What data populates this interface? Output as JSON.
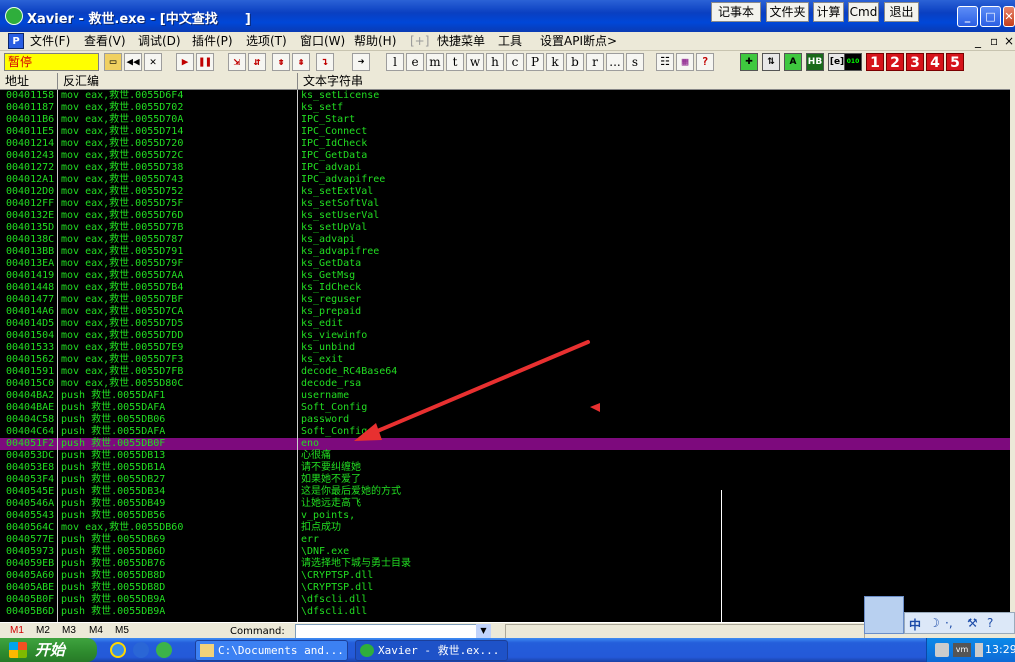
{
  "window": {
    "title": "Xavier - 救世.exe - [中文查找      ]",
    "buttons": [
      "记事本",
      "文件夹",
      "计算",
      "Cmd",
      "退出"
    ],
    "controls": [
      "_",
      "□",
      "✕"
    ]
  },
  "menu": {
    "items": [
      "文件(F)",
      "查看(V)",
      "调试(D)",
      "插件(P)",
      "选项(T)",
      "窗口(W)",
      "帮助(H)",
      "[+]",
      "快捷菜单",
      "工具",
      "设置API断点>"
    ],
    "right_controls": [
      "_",
      "▫",
      "×"
    ]
  },
  "toolbar": {
    "status": "暂停",
    "letters": [
      "l",
      "e",
      "m",
      "t",
      "w",
      "h",
      "c",
      "P",
      "k",
      "b",
      "r",
      "...",
      "s"
    ],
    "numbers": [
      "1",
      "2",
      "3",
      "4",
      "5"
    ]
  },
  "columns": {
    "address": "地址",
    "disasm": "反汇编",
    "string": "文本字符串"
  },
  "rows": [
    {
      "addr": "00401158",
      "asm": "mov eax,救世.0055D6F4",
      "str": "ks_setLicense"
    },
    {
      "addr": "00401187",
      "asm": "mov eax,救世.0055D702",
      "str": "ks_setf"
    },
    {
      "addr": "004011B6",
      "asm": "mov eax,救世.0055D70A",
      "str": "IPC_Start"
    },
    {
      "addr": "004011E5",
      "asm": "mov eax,救世.0055D714",
      "str": "IPC_Connect"
    },
    {
      "addr": "00401214",
      "asm": "mov eax,救世.0055D720",
      "str": "IPC_IdCheck"
    },
    {
      "addr": "00401243",
      "asm": "mov eax,救世.0055D72C",
      "str": "IPC_GetData"
    },
    {
      "addr": "00401272",
      "asm": "mov eax,救世.0055D738",
      "str": "IPC_advapi"
    },
    {
      "addr": "004012A1",
      "asm": "mov eax,救世.0055D743",
      "str": "IPC_advapifree"
    },
    {
      "addr": "004012D0",
      "asm": "mov eax,救世.0055D752",
      "str": "ks_setExtVal"
    },
    {
      "addr": "004012FF",
      "asm": "mov eax,救世.0055D75F",
      "str": "ks_setSoftVal"
    },
    {
      "addr": "0040132E",
      "asm": "mov eax,救世.0055D76D",
      "str": "ks_setUserVal"
    },
    {
      "addr": "0040135D",
      "asm": "mov eax,救世.0055D77B",
      "str": "ks_setUpVal"
    },
    {
      "addr": "0040138C",
      "asm": "mov eax,救世.0055D787",
      "str": "ks_advapi"
    },
    {
      "addr": "004013BB",
      "asm": "mov eax,救世.0055D791",
      "str": "ks_advapifree"
    },
    {
      "addr": "004013EA",
      "asm": "mov eax,救世.0055D79F",
      "str": "ks_GetData"
    },
    {
      "addr": "00401419",
      "asm": "mov eax,救世.0055D7AA",
      "str": "ks_GetMsg"
    },
    {
      "addr": "00401448",
      "asm": "mov eax,救世.0055D7B4",
      "str": "ks_IdCheck"
    },
    {
      "addr": "00401477",
      "asm": "mov eax,救世.0055D7BF",
      "str": "ks_reguser"
    },
    {
      "addr": "004014A6",
      "asm": "mov eax,救世.0055D7CA",
      "str": "ks_prepaid"
    },
    {
      "addr": "004014D5",
      "asm": "mov eax,救世.0055D7D5",
      "str": "ks_edit"
    },
    {
      "addr": "00401504",
      "asm": "mov eax,救世.0055D7DD",
      "str": "ks_viewinfo"
    },
    {
      "addr": "00401533",
      "asm": "mov eax,救世.0055D7E9",
      "str": "ks_unbind"
    },
    {
      "addr": "00401562",
      "asm": "mov eax,救世.0055D7F3",
      "str": "ks_exit"
    },
    {
      "addr": "00401591",
      "asm": "mov eax,救世.0055D7FB",
      "str": "decode_RC4Base64"
    },
    {
      "addr": "004015C0",
      "asm": "mov eax,救世.0055D80C",
      "str": "decode_rsa"
    },
    {
      "addr": "00404BA2",
      "asm": "push 救世.0055DAF1",
      "str": "username"
    },
    {
      "addr": "00404BAE",
      "asm": "push 救世.0055DAFA",
      "str": "Soft_Config"
    },
    {
      "addr": "00404C58",
      "asm": "push 救世.0055DB06",
      "str": "password"
    },
    {
      "addr": "00404C64",
      "asm": "push 救世.0055DAFA",
      "str": "Soft_Config"
    },
    {
      "addr": "004051F2",
      "asm": "push 救世.0055DB0F",
      "str": "eno"
    },
    {
      "addr": "004053DC",
      "asm": "push 救世.0055DB13",
      "str": "心很痛"
    },
    {
      "addr": "004053E8",
      "asm": "push 救世.0055DB1A",
      "str": "请不要纠缠她"
    },
    {
      "addr": "004053F4",
      "asm": "push 救世.0055DB27",
      "str": "如果她不爱了"
    },
    {
      "addr": "0040545E",
      "asm": "push 救世.0055DB34",
      "str": "这是你最后爱她的方式"
    },
    {
      "addr": "0040546A",
      "asm": "push 救世.0055DB49",
      "str": "让她远走高飞"
    },
    {
      "addr": "00405543",
      "asm": "push 救世.0055DB56",
      "str": "v_points,"
    },
    {
      "addr": "0040564C",
      "asm": "mov eax,救世.0055DB60",
      "str": "扣点成功"
    },
    {
      "addr": "0040577E",
      "asm": "push 救世.0055DB69",
      "str": "err"
    },
    {
      "addr": "00405973",
      "asm": "push 救世.0055DB6D",
      "str": "\\DNF.exe"
    },
    {
      "addr": "004059EB",
      "asm": "push 救世.0055DB76",
      "str": "请选择地下城与勇士目录"
    },
    {
      "addr": "00405A60",
      "asm": "push 救世.0055DB8D",
      "str": "\\CRYPTSP.dll"
    },
    {
      "addr": "00405ABE",
      "asm": "push 救世.0055DB8D",
      "str": "\\CRYPTSP.dll"
    },
    {
      "addr": "00405B0F",
      "asm": "push 救世.0055DB9A",
      "str": "\\dfscli.dll"
    },
    {
      "addr": "00405B6D",
      "asm": "push 救世.0055DB9A",
      "str": "\\dfscli.dll"
    }
  ],
  "selected_row_index": 29,
  "bottom": {
    "mtabs": [
      "M1",
      "M2",
      "M3",
      "M4",
      "M5"
    ],
    "command_label": "Command:"
  },
  "taskbar": {
    "start": "开始",
    "tasks": [
      "C:\\Documents and...",
      "Xavier - 救世.ex..."
    ],
    "clock": "13:29",
    "ime": "中"
  },
  "colors": {
    "list_bg": "#000000",
    "list_text": "#22dd22",
    "selection": "#7d0a7d",
    "status_bg": "#ffff00",
    "arrow": "#e83030"
  }
}
